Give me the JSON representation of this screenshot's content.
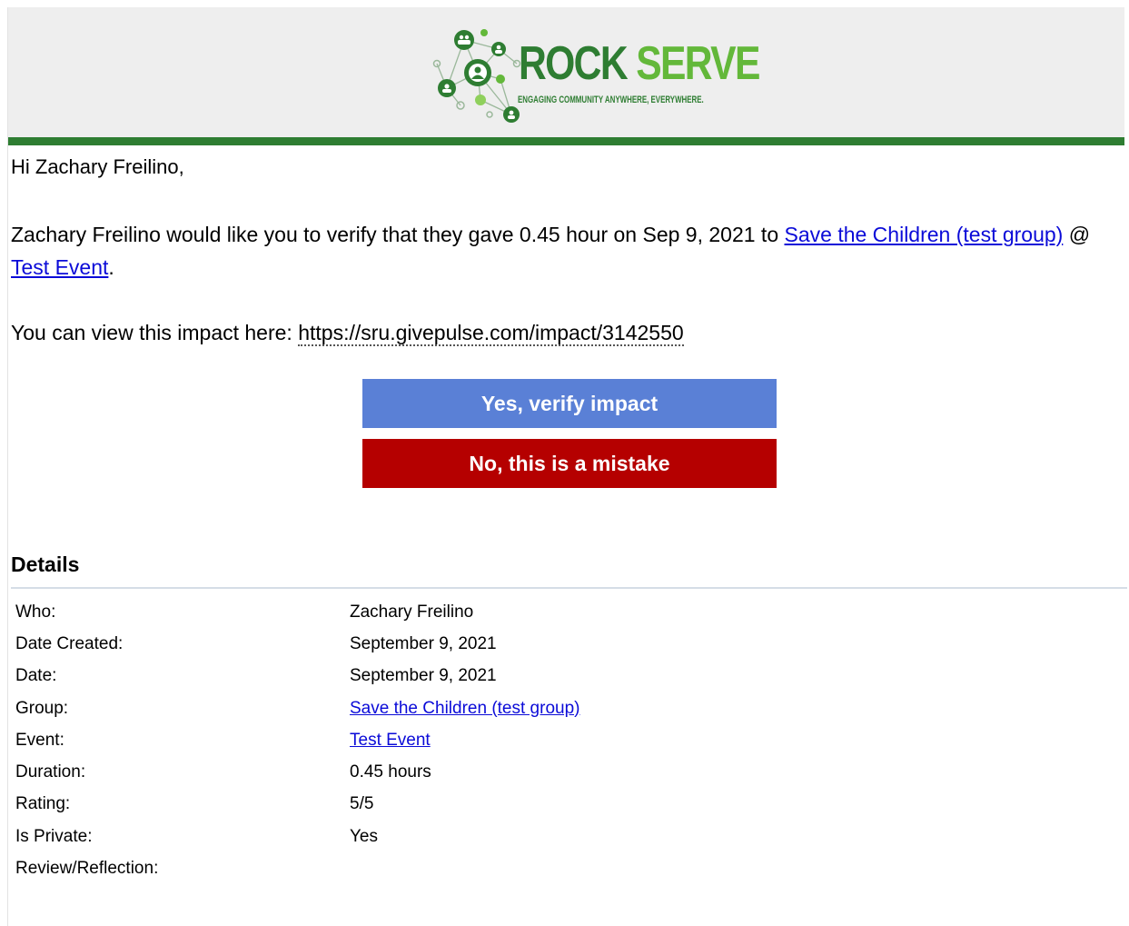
{
  "header": {
    "logo": {
      "word_rock": "ROCK",
      "word_serve": "SERVE",
      "tagline": "ENGAGING COMMUNITY ANYWHERE, EVERYWHERE."
    },
    "accent_color": "#2e7d32"
  },
  "greeting": "Hi Zachary Freilino,",
  "message": {
    "text_before": "Zachary Freilino would like you to verify that they gave 0.45 hour on Sep 9, 2021 to ",
    "group_link": "Save the Children (test group)",
    "separator": " @ ",
    "event_link": "Test Event",
    "text_after": "."
  },
  "impact": {
    "label": "You can view this impact here: ",
    "url": "https://sru.givepulse.com/impact/3142550"
  },
  "buttons": {
    "verify_label": "Yes, verify impact",
    "verify_color": "#5a80d6",
    "mistake_label": "No, this is a mistake",
    "mistake_color": "#b50000"
  },
  "details": {
    "heading": "Details",
    "rows": [
      {
        "label": "Who:",
        "value": "Zachary Freilino"
      },
      {
        "label": "Date Created:",
        "value": "September 9, 2021"
      },
      {
        "label": "Date:",
        "value": "September 9, 2021"
      },
      {
        "label": "Group:",
        "value": "Save the Children (test group)"
      },
      {
        "label": "Event:",
        "value": "Test Event"
      },
      {
        "label": "Duration:",
        "value": "0.45 hours"
      },
      {
        "label": "Rating:",
        "value": "5/5"
      },
      {
        "label": "Is Private:",
        "value": "Yes"
      },
      {
        "label": "Review/Reflection:",
        "value": ""
      }
    ]
  }
}
